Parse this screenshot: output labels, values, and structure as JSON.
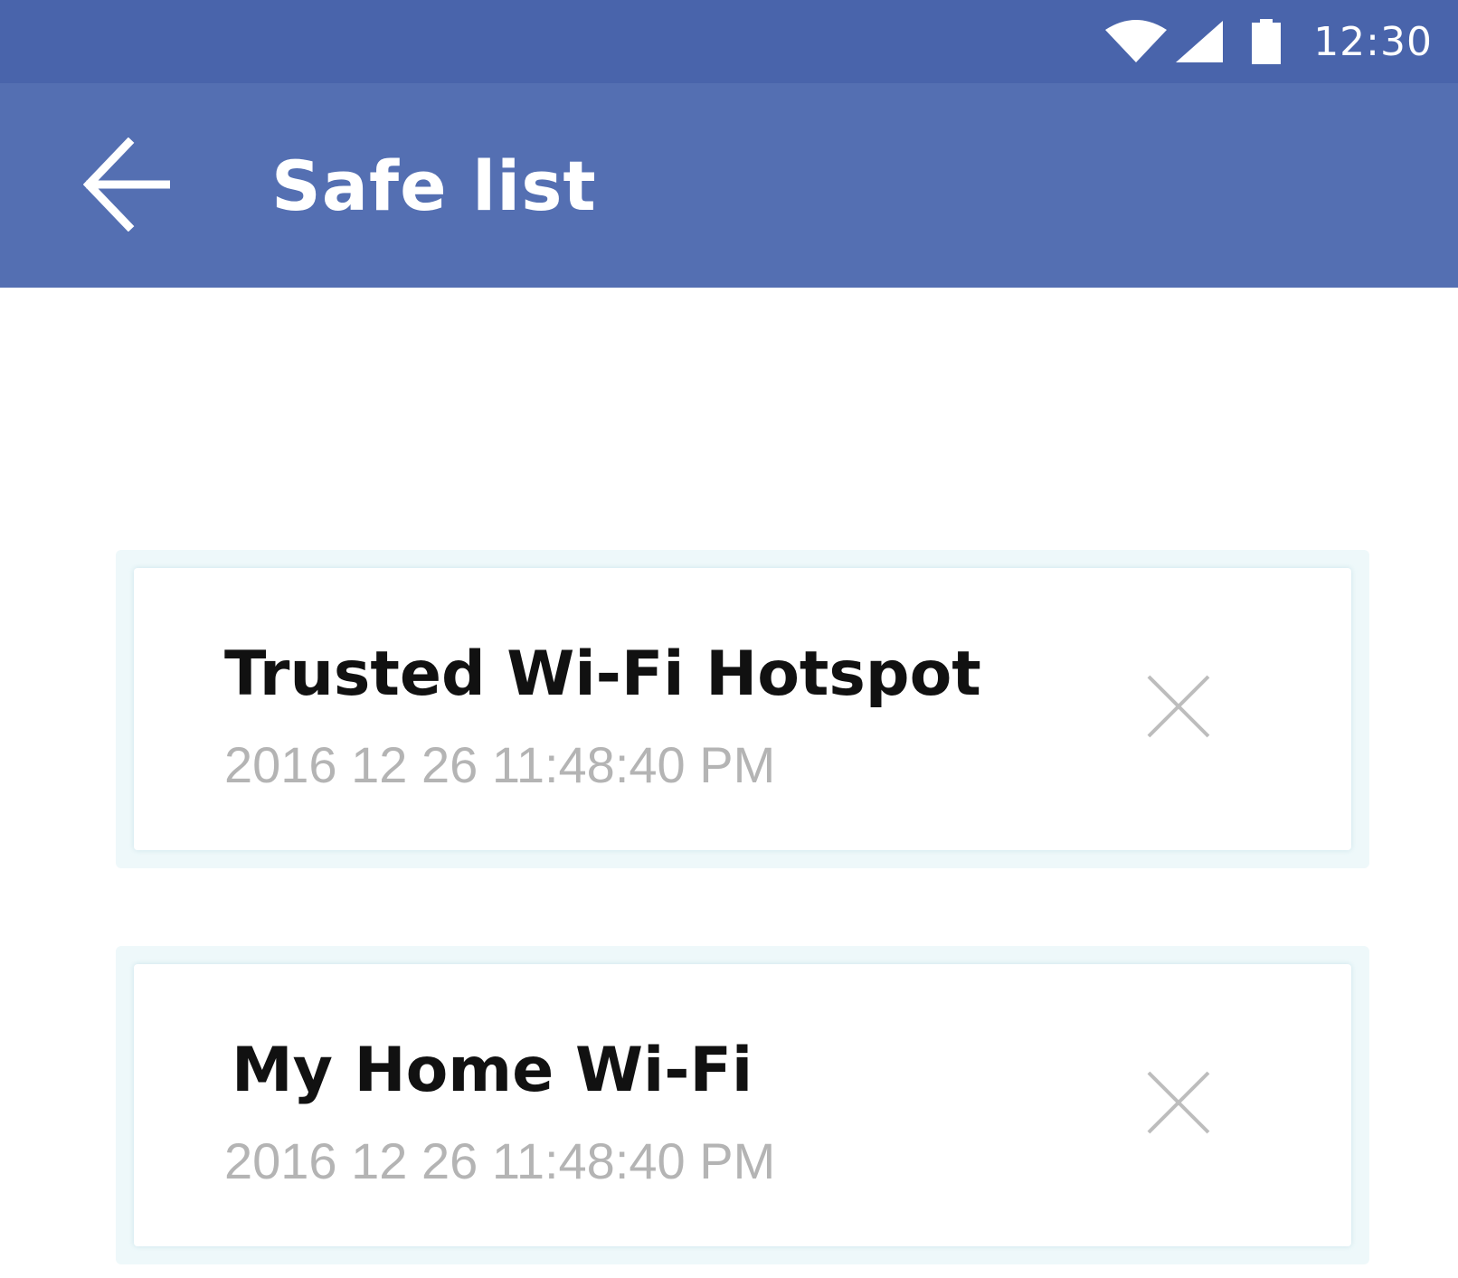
{
  "status_bar": {
    "time": "12:30",
    "icons": [
      "wifi-icon",
      "cellular-signal-icon",
      "battery-icon"
    ]
  },
  "header": {
    "back_icon": "arrow-left-icon",
    "title": "Safe list"
  },
  "safe_list": {
    "items": [
      {
        "name": "Trusted Wi-Fi Hotspot",
        "date": "2016 12 26 11:48:40 PM",
        "remove_icon": "close-icon"
      },
      {
        "name": "My Home Wi-Fi",
        "date": "2016 12 26 11:48:40 PM",
        "remove_icon": "close-icon"
      }
    ]
  },
  "colors": {
    "status_bar": "#4964ab",
    "app_bar": "#546fb2",
    "title_text": "#ffffff",
    "item_title": "#111111",
    "item_date": "#b4b4b4",
    "card_border": "#eef8fa"
  }
}
